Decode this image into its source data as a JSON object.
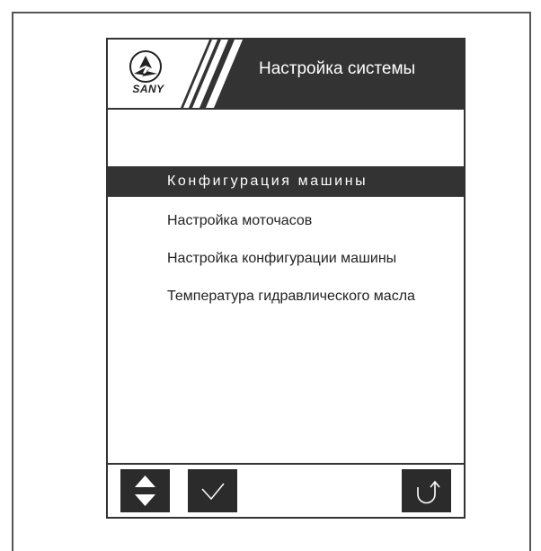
{
  "header": {
    "brand": "SANY",
    "title": "Настройка системы"
  },
  "menu": {
    "items": [
      {
        "label": "Конфигурация машины",
        "selected": true
      },
      {
        "label": "Настройка моточасов",
        "selected": false
      },
      {
        "label": "Настройка конфигурации машины",
        "selected": false
      },
      {
        "label": "Температура гидравлического масла",
        "selected": false
      }
    ]
  },
  "footer": {
    "buttons": [
      {
        "icon": "up-down-arrows-icon"
      },
      {
        "icon": "checkmark-icon"
      },
      {
        "icon": "back-return-icon"
      }
    ]
  },
  "colors": {
    "dark": "#333333",
    "text_on_dark": "#ffffff"
  }
}
